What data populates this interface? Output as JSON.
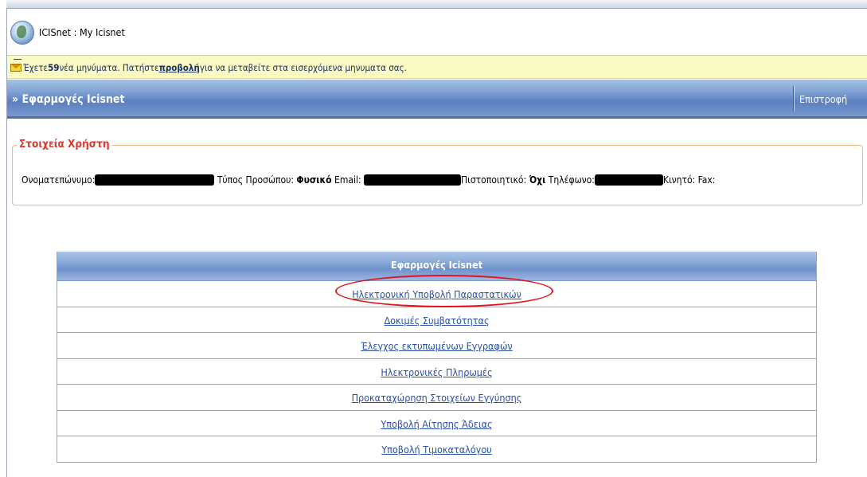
{
  "titlebar": {
    "title": "ICISnet : My Icisnet"
  },
  "messages": {
    "prefix": "Έχετε",
    "count": "59",
    "middle": "νέα μηνύματα. Πατήστε",
    "link": "προβολή",
    "suffix": "για να μεταβείτε στα εισερχόμενα μηνυματα σας."
  },
  "header": {
    "title": "» Εφαρμογές Icisnet",
    "back_label": "Επιστροφή"
  },
  "user": {
    "legend": "Στοιχεία Χρήστη",
    "name_label": "Ονοματεπώνυμο:",
    "type_label": "Τύπος Προσώπου:",
    "type_value": "Φυσικό",
    "email_label": "Email:",
    "cert_label": "Πιστοποιητικό:",
    "cert_value": "Όχι",
    "phone_label": "Τηλέφωνο:",
    "mobile_label": "Κινητό:",
    "fax_label": "Fax:"
  },
  "apps": {
    "header": "Εφαρμογές Icisnet",
    "items": [
      "Ηλεκτρονική Υποβολή Παραστατικών",
      "Δοκιμές Συμβατότητας",
      "Έλεγχος εκτυπωμένων Εγγραφών",
      "Ηλεκτρονικές Πληρωμές",
      "Προκαταχώρηση Στοιχείων Εγγύησης",
      "Υποβολή Αίτησης Άδειας",
      "Υποβολή Τιμοκαταλόγου"
    ]
  },
  "colors": {
    "header_blue": "#5b80c0",
    "legend_red": "#d63b2f",
    "link_blue": "#2a4fa8",
    "highlight_red": "#e0141c",
    "message_bg": "#fbf9c2"
  }
}
